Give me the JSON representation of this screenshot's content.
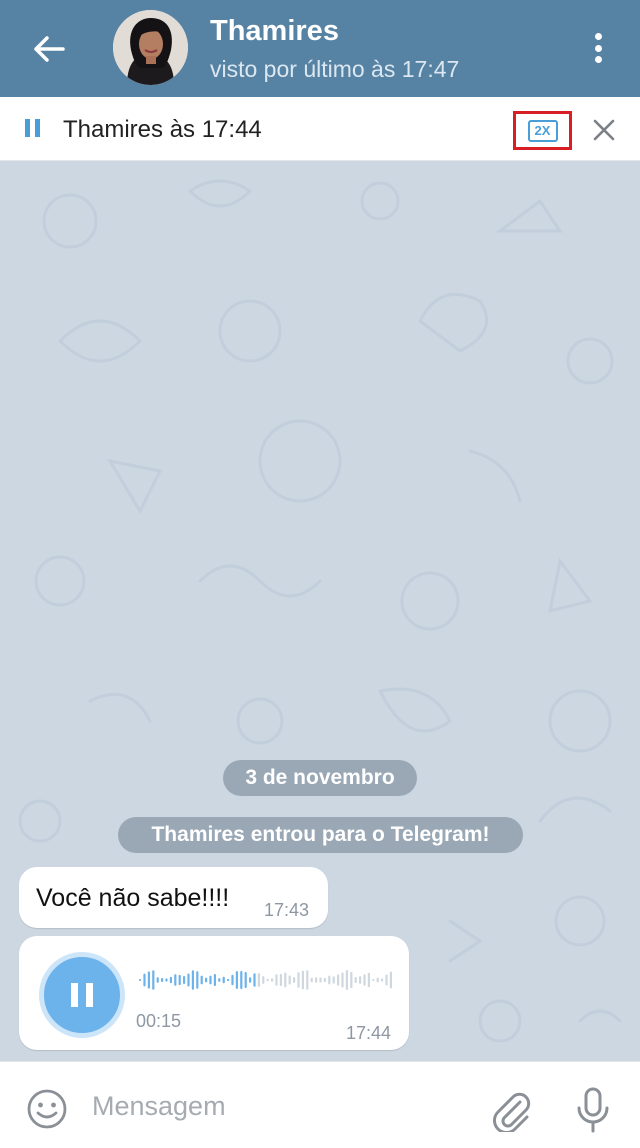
{
  "header": {
    "title": "Thamires",
    "subtitle": "visto por último às 17:47"
  },
  "player": {
    "title": "Thamires às 17:44",
    "speed_label": "2X"
  },
  "chat": {
    "date_label": "3 de novembro",
    "service_message": "Thamires entrou para o Telegram!",
    "messages": [
      {
        "text": "Você não sabe!!!!",
        "time": "17:43"
      },
      {
        "type": "voice",
        "duration": "00:15",
        "time": "17:44"
      }
    ]
  },
  "input": {
    "placeholder": "Mensagem"
  },
  "colors": {
    "header_bg": "#5682a3",
    "accent": "#4a9ed8",
    "chat_bg": "#ccd7e2",
    "highlight": "#d81f26"
  }
}
